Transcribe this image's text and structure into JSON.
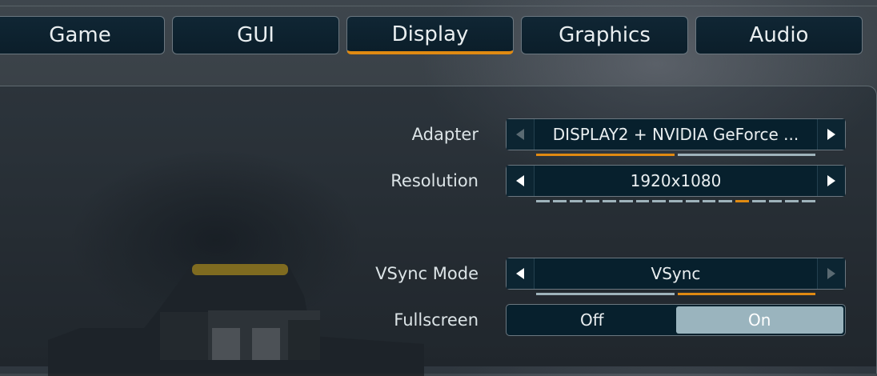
{
  "tabs": [
    {
      "label": "Game"
    },
    {
      "label": "GUI"
    },
    {
      "label": "Display",
      "active": true
    },
    {
      "label": "Graphics"
    },
    {
      "label": "Audio"
    }
  ],
  "settings": {
    "adapter": {
      "label": "Adapter",
      "value": "DISPLAY2 + NVIDIA GeForce ...",
      "option_count": 2,
      "selected_index": 0
    },
    "resolution": {
      "label": "Resolution",
      "value": "1920x1080",
      "option_count": 17,
      "selected_index": 12
    },
    "vsync": {
      "label": "VSync Mode",
      "value": "VSync",
      "option_count": 2,
      "selected_index": 1
    },
    "fullscreen": {
      "label": "Fullscreen",
      "options": [
        "Off",
        "On"
      ],
      "selected": "On"
    }
  },
  "colors": {
    "accent": "#e08a12",
    "panel": "#07202d",
    "toggle_selected": "#9ab4be"
  }
}
